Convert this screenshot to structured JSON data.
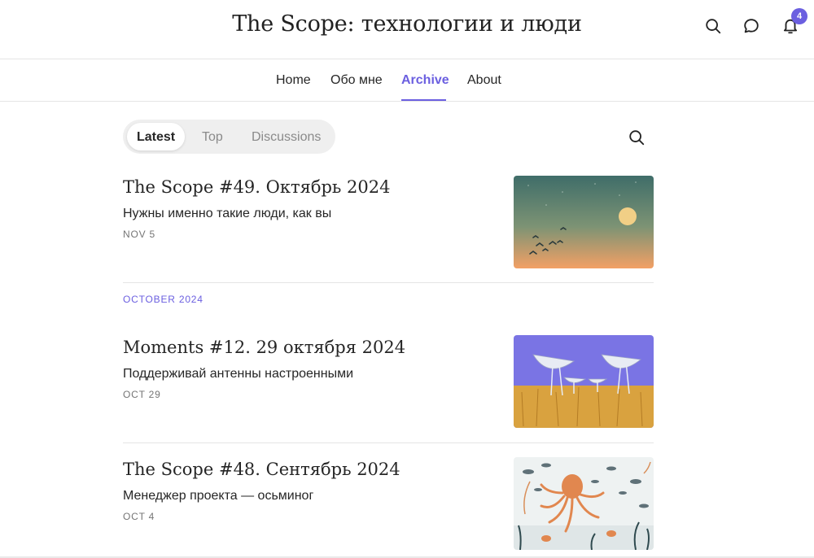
{
  "header": {
    "title": "The Scope: технологии и люди",
    "notification_count": "4",
    "icons": [
      "search-icon",
      "chat-icon",
      "bell-icon"
    ]
  },
  "nav": {
    "items": [
      {
        "label": "Home",
        "active": false
      },
      {
        "label": "Обо мне",
        "active": false
      },
      {
        "label": "Archive",
        "active": true
      },
      {
        "label": "About",
        "active": false
      }
    ]
  },
  "tabs": {
    "items": [
      {
        "label": "Latest",
        "active": true
      },
      {
        "label": "Top",
        "active": false
      },
      {
        "label": "Discussions",
        "active": false
      }
    ]
  },
  "posts": [
    {
      "title": "The Scope #49. Октябрь 2024",
      "subtitle": "Нужны именно такие люди, как вы",
      "date": "NOV 5",
      "image": "birds-at-dusk"
    },
    {
      "title": "Moments #12. 29 октября 2024",
      "subtitle": "Поддерживай антенны настроенными",
      "date": "OCT 29",
      "image": "radio-telescopes-field"
    },
    {
      "title": "The Scope #48. Сентябрь 2024",
      "subtitle": "Менеджер проекта — осьминог",
      "date": "OCT 4",
      "image": "octopus-with-fish"
    }
  ],
  "sections": {
    "month_label": "OCTOBER 2024"
  },
  "colors": {
    "accent": "#6b5fe0",
    "text": "#262626",
    "muted": "#757575",
    "divider": "#e5e5e5"
  }
}
